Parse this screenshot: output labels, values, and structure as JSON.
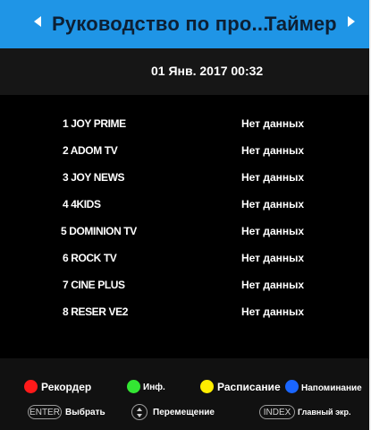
{
  "header": {
    "title": "Руководство по про...",
    "tab": "Таймер"
  },
  "datetime": "01 Янв. 2017  00:32",
  "channels": [
    {
      "name": "1  JOY PRIME",
      "status": "Нет данных"
    },
    {
      "name": "2  ADOM TV",
      "status": "Нет данных"
    },
    {
      "name": "3  JOY NEWS",
      "status": "Нет данных"
    },
    {
      "name": "4  4KIDS",
      "status": "Нет данных"
    },
    {
      "name": "5  DOMINION TV",
      "status": "Нет данных"
    },
    {
      "name": "6  ROCK TV",
      "status": "Нет данных"
    },
    {
      "name": "7  CINE PLUS",
      "status": "Нет данных"
    },
    {
      "name": "8  RESER VE2",
      "status": "Нет данных"
    }
  ],
  "legend": {
    "red": {
      "label": "Рекордер",
      "color": "#ff1a1a"
    },
    "green": {
      "label": "Инф.",
      "color": "#33e633"
    },
    "yellow": {
      "label": "Расписание",
      "color": "#ffee00"
    },
    "blue": {
      "label": "Напоминание",
      "color": "#1a66ff"
    }
  },
  "keys": {
    "enter": {
      "key": "ENTER",
      "label": "Выбрать"
    },
    "move": {
      "label": "Перемещение"
    },
    "index": {
      "key": "INDEX",
      "label": "Главный экр."
    }
  }
}
